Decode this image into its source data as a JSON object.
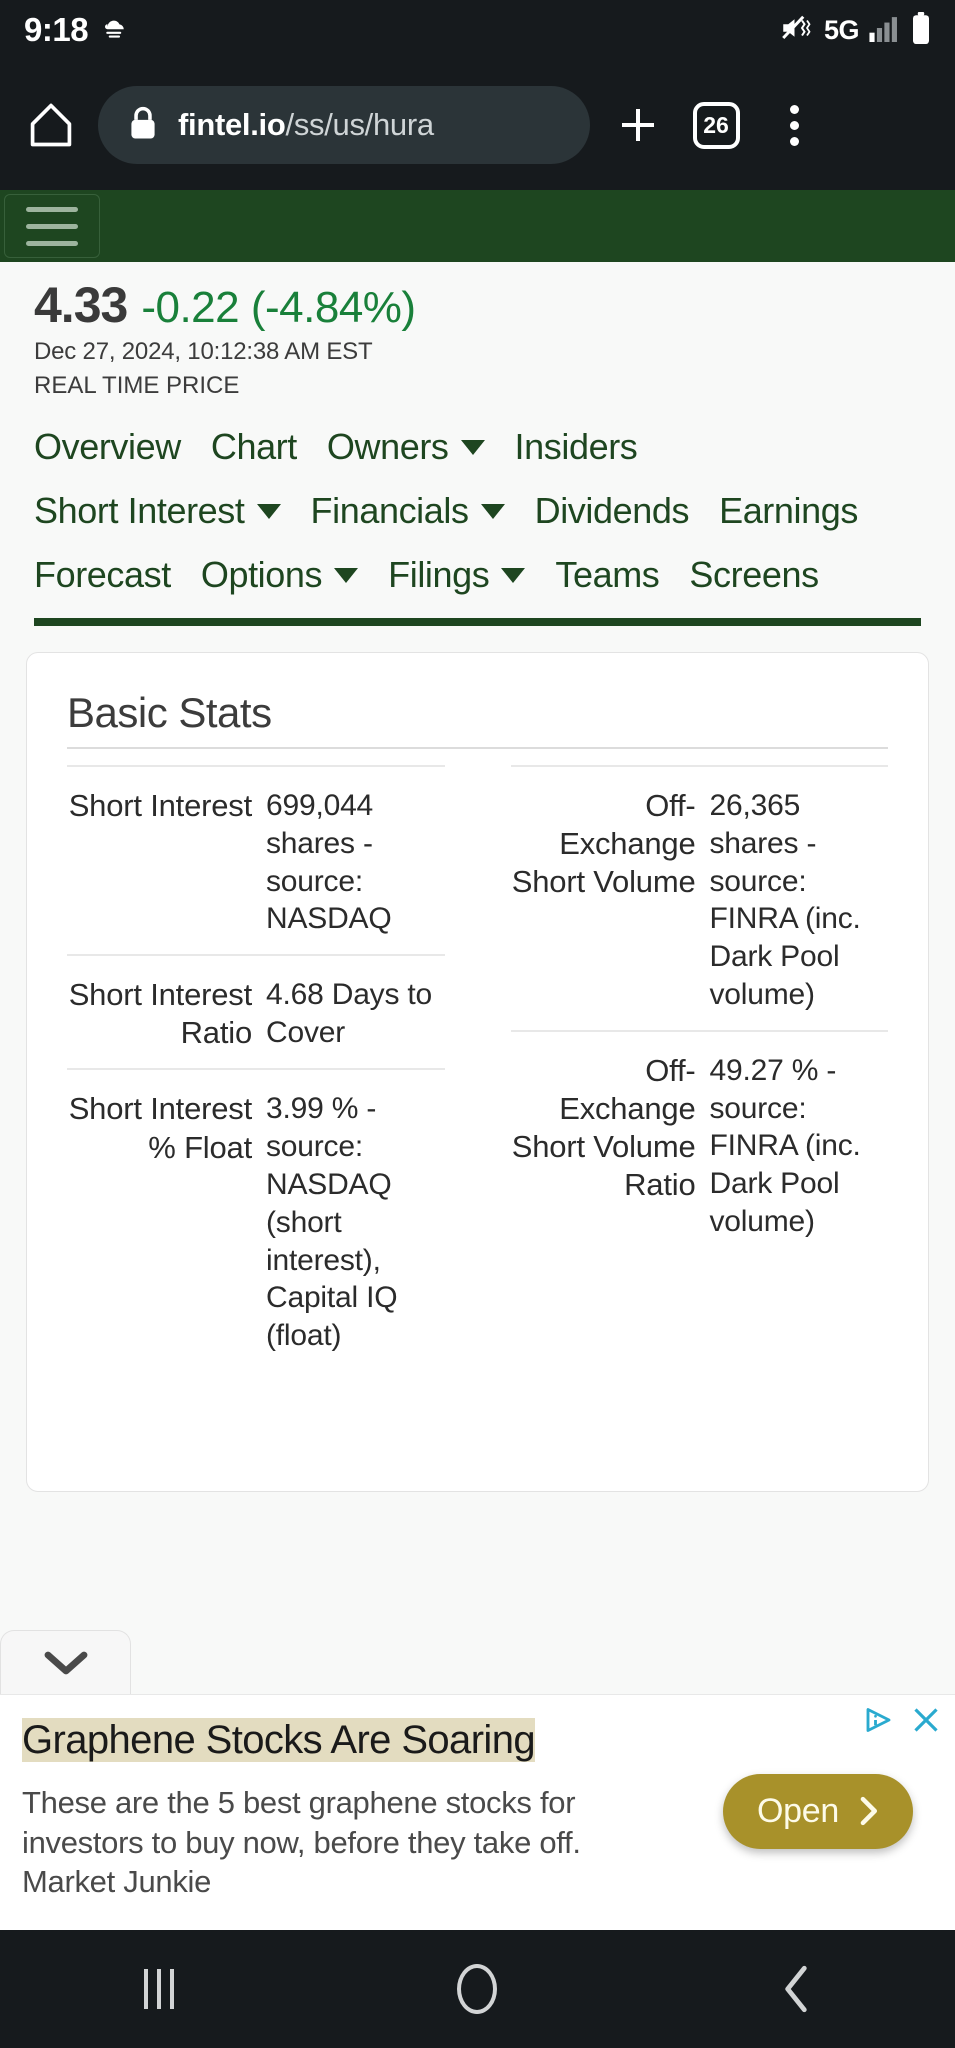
{
  "status_bar": {
    "clock": "9:18",
    "weather_icon": "cloud-icon",
    "mute_icon": "mute-icon",
    "network": "5G",
    "signal_icon": "signal-bars-icon",
    "battery_icon": "battery-icon"
  },
  "browser": {
    "home_icon": "home-icon",
    "lock_icon": "lock-icon",
    "url_prefix": "fintel.io",
    "url_suffix": "/ss/us/hura",
    "url_full": "fintel.io/ss/us/hura",
    "new_tab_icon": "plus-icon",
    "tab_count": "26",
    "menu_icon": "kebab-menu-icon"
  },
  "site_header": {
    "menu_icon": "hamburger-menu-icon"
  },
  "quote": {
    "price": "4.33",
    "change": "-0.22 (-4.84%)",
    "change_color": "#19803a",
    "timestamp": "Dec 27, 2024, 10:12:38 AM EST",
    "realtime_label": "REAL TIME PRICE"
  },
  "nav": {
    "rows": [
      [
        {
          "label": "Overview",
          "has_caret": false
        },
        {
          "label": "Chart",
          "has_caret": false
        },
        {
          "label": "Owners",
          "has_caret": true
        },
        {
          "label": "Insiders",
          "has_caret": false
        }
      ],
      [
        {
          "label": "Short Interest",
          "has_caret": true
        },
        {
          "label": "Financials",
          "has_caret": true
        },
        {
          "label": "Dividends",
          "has_caret": false
        },
        {
          "label": "Earnings",
          "has_caret": false
        }
      ],
      [
        {
          "label": "Forecast",
          "has_caret": false
        },
        {
          "label": "Options",
          "has_caret": true
        },
        {
          "label": "Filings",
          "has_caret": true
        },
        {
          "label": "Teams",
          "has_caret": false
        },
        {
          "label": "Screens",
          "has_caret": false
        }
      ]
    ],
    "accent_color": "#1e4620"
  },
  "basic_stats": {
    "title": "Basic Stats",
    "left_column": [
      {
        "label": "Short Interest",
        "value": "699,044 shares - source: NASDAQ"
      },
      {
        "label": "Short Interest Ratio",
        "value": "4.68 Days to Cover"
      },
      {
        "label": "Short Interest % Float",
        "value": "3.99 % - source: NASDAQ (short interest), Capital IQ (float)"
      }
    ],
    "right_column": [
      {
        "label": "Off-Exchange Short Volume",
        "value": "26,365 shares - source: FINRA (inc. Dark Pool volume)"
      },
      {
        "label": "Off-Exchange Short Volume Ratio",
        "value": "49.27 % - source: FINRA (inc. Dark Pool volume)"
      }
    ]
  },
  "ad": {
    "collapse_icon": "chevron-down-icon",
    "adchoices_icon": "adchoices-icon",
    "close_icon": "close-x-icon",
    "title": "Graphene Stocks Are Soaring",
    "body": "These are the 5 best graphene stocks for investors to buy now, before they take off.",
    "advertiser": "Market Junkie",
    "cta_label": "Open",
    "cta_arrow_icon": "chevron-right-icon",
    "cta_color": "#a8912a"
  },
  "system_nav": {
    "recents_icon": "recents-icon",
    "home_icon": "home-pill-icon",
    "back_icon": "back-chevron-icon"
  }
}
